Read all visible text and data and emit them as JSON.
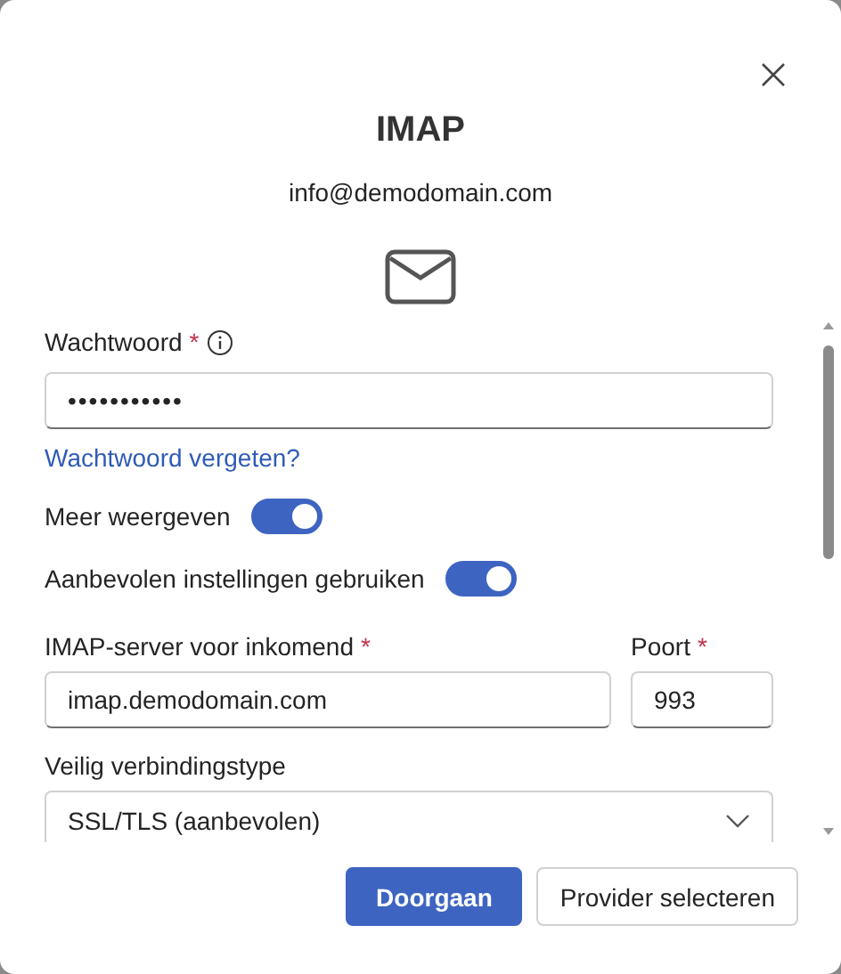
{
  "dialog": {
    "title": "IMAP",
    "account": "info@demodomain.com"
  },
  "password": {
    "label": "Wachtwoord",
    "required_mark": "*",
    "value": "•••••••••••",
    "forgot_link": "Wachtwoord vergeten?"
  },
  "toggles": [
    {
      "label": "Meer weergeven",
      "on": true
    },
    {
      "label": "Aanbevolen instellingen gebruiken",
      "on": true
    }
  ],
  "server": {
    "label": "IMAP-server voor inkomend",
    "required_mark": "*",
    "value": "imap.demodomain.com"
  },
  "port": {
    "label": "Poort",
    "required_mark": "*",
    "value": "993"
  },
  "connection": {
    "label": "Veilig verbindingstype",
    "value": "SSL/TLS (aanbevolen)"
  },
  "buttons": [
    {
      "label": "Doorgaan",
      "kind": "primary"
    },
    {
      "label": "Provider selecteren",
      "kind": "secondary"
    }
  ]
}
